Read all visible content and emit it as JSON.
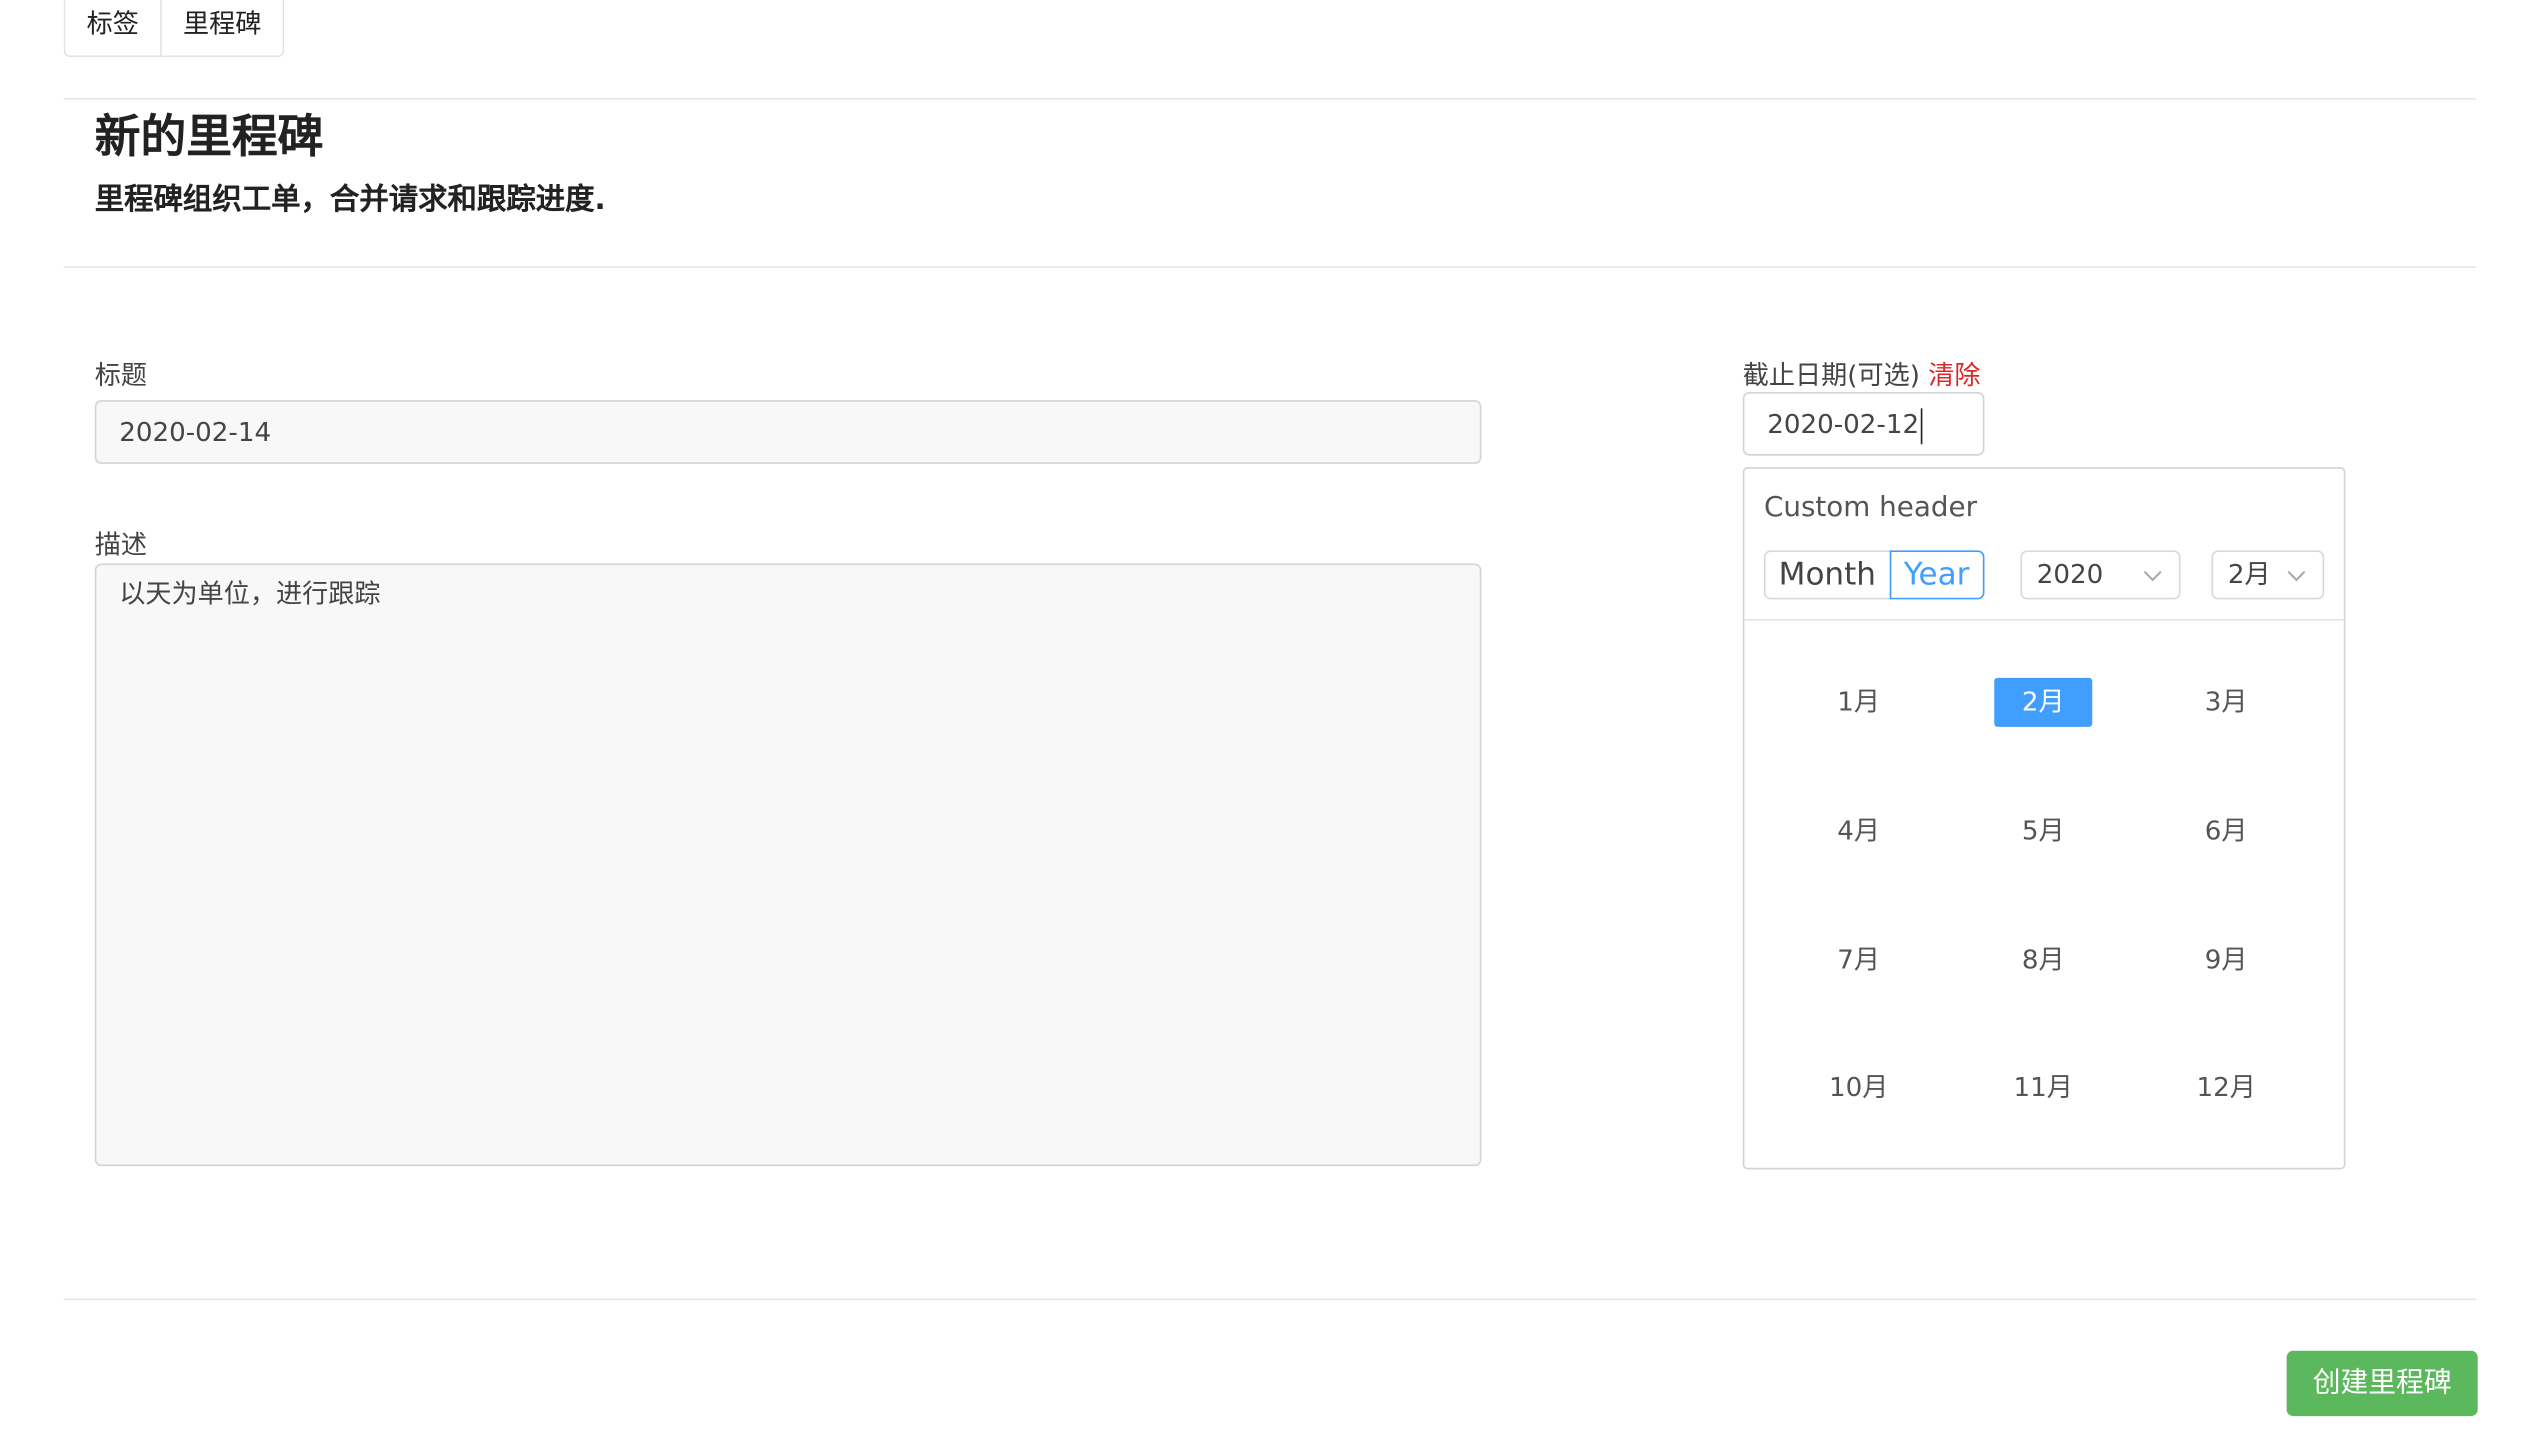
{
  "tabs": [
    {
      "label": "标签"
    },
    {
      "label": "里程碑"
    }
  ],
  "header": {
    "title": "新的里程碑",
    "subtitle": "里程碑组织工单，合并请求和跟踪进度."
  },
  "form": {
    "title_label": "标题",
    "title_value": "2020-02-14",
    "description_label": "描述",
    "description_value": "以天为单位，进行跟踪",
    "due_date_label": "截止日期(可选)",
    "due_date_clear": "清除",
    "due_date_value": "2020-02-12"
  },
  "calendar": {
    "header_title": "Custom header",
    "mode_month": "Month",
    "mode_year": "Year",
    "active_mode": "Year",
    "year_value": "2020",
    "month_value": "2月",
    "months": [
      "1月",
      "2月",
      "3月",
      "4月",
      "5月",
      "6月",
      "7月",
      "8月",
      "9月",
      "10月",
      "11月",
      "12月"
    ],
    "selected_month": "2月"
  },
  "footer": {
    "create_button": "创建里程碑"
  },
  "colors": {
    "accent": "#409eff",
    "success": "#5cb85c",
    "danger": "#db2828"
  }
}
